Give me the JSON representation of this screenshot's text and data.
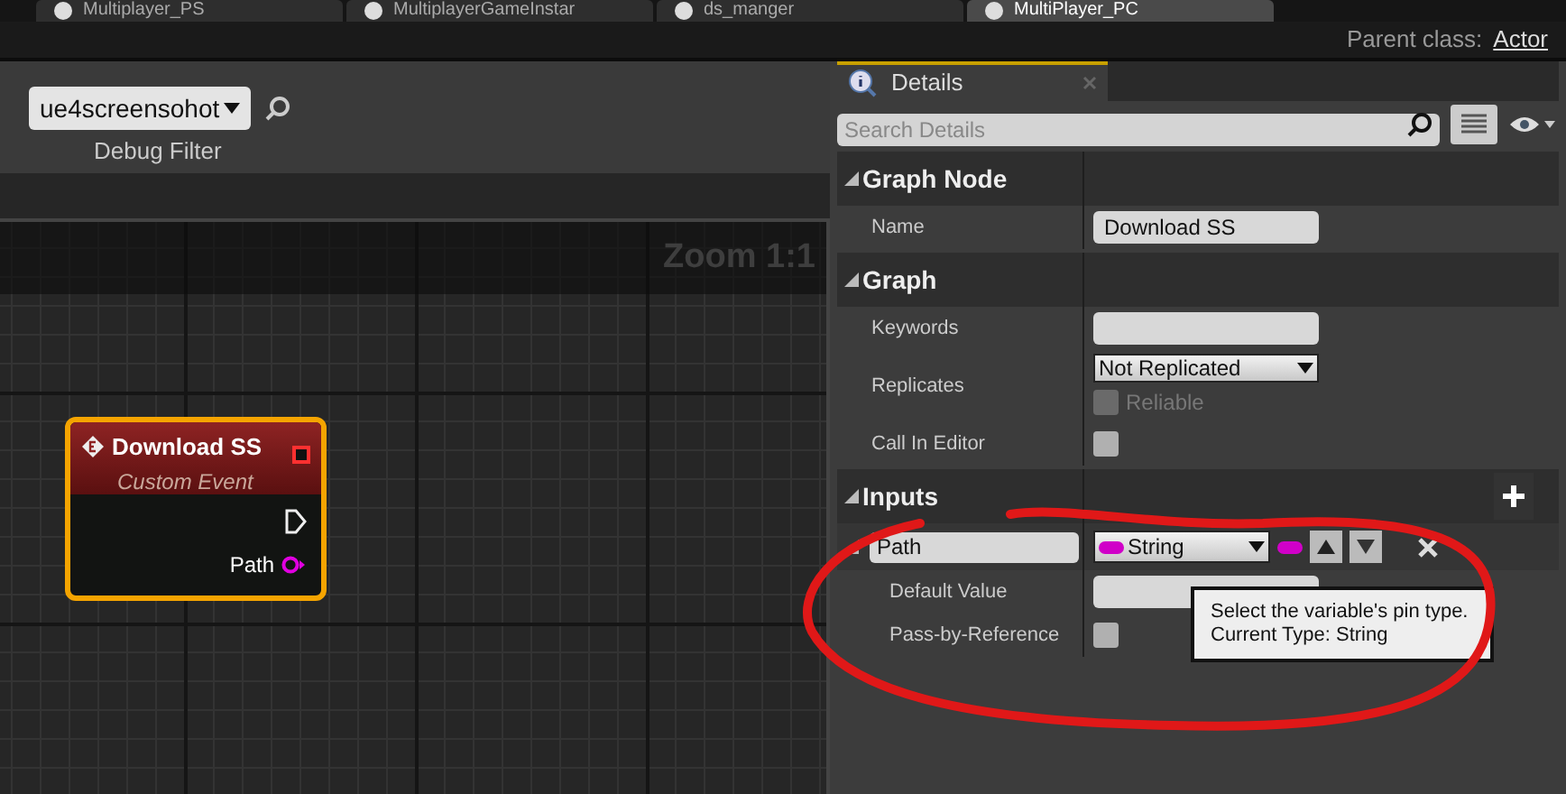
{
  "document_tabs": [
    {
      "label": "Multiplayer_PS",
      "selected": false
    },
    {
      "label": "MultiplayerGameInstar",
      "selected": false
    },
    {
      "label": "ds_manger",
      "selected": false
    },
    {
      "label": "MultiPlayer_PC",
      "selected": true
    }
  ],
  "parent_class": {
    "label": "Parent class:",
    "value": "Actor"
  },
  "debug_filter": {
    "value": "ue4screensohot",
    "label": "Debug Filter"
  },
  "graph": {
    "zoom": "Zoom 1:1",
    "node": {
      "title": "Download SS",
      "subtitle": "Custom Event",
      "pin": "Path",
      "selected": true
    }
  },
  "details": {
    "tab": "Details",
    "search": {
      "placeholder": "Search Details"
    },
    "sections": [
      {
        "title": "Graph Node",
        "expanded": true,
        "rows": [
          {
            "kind": "field",
            "label": "Name",
            "value": "Download SS"
          }
        ]
      },
      {
        "title": "Graph",
        "expanded": true,
        "rows": [
          {
            "kind": "field",
            "label": "Keywords",
            "value": ""
          },
          {
            "kind": "dropdown",
            "label": "Replicates",
            "value": "Not Replicated",
            "option": {
              "label": "Reliable",
              "checked": false,
              "disabled": true
            }
          },
          {
            "kind": "checkbox",
            "label": "Call In Editor",
            "checked": false
          }
        ]
      },
      {
        "title": "Inputs",
        "expanded": true,
        "add": true,
        "params": [
          {
            "name": "Path",
            "type": "String",
            "expanded": true,
            "rows": [
              {
                "kind": "field",
                "label": "Default Value",
                "value": ""
              },
              {
                "kind": "checkbox",
                "label": "Pass-by-Reference",
                "checked": false
              }
            ]
          }
        ]
      }
    ],
    "tooltip": [
      "Select the variable's pin type.",
      "Current Type: String"
    ]
  }
}
